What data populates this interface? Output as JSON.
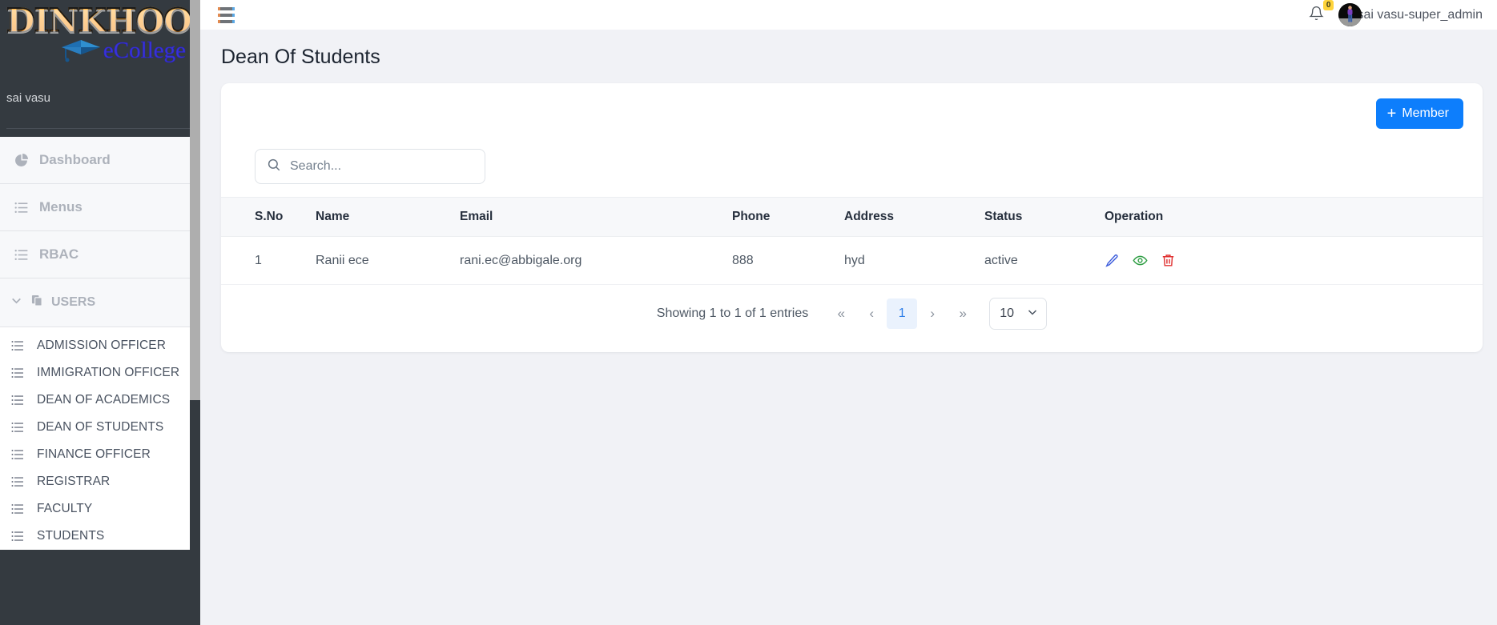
{
  "brand": {
    "title_top": "DINKHOO!",
    "title_bottom": "eCollege",
    "cap_icon": "graduation-cap-icon",
    "username": "sai vasu"
  },
  "sidebar": {
    "top_items": [
      {
        "label": "Dashboard",
        "icon": "pie-chart-icon"
      },
      {
        "label": "Menus",
        "icon": "list-icon"
      },
      {
        "label": "RBAC",
        "icon": "list-icon"
      }
    ],
    "users_group": {
      "label": "USERS",
      "icon": "copy-icon",
      "chevron": "chevron-down-icon",
      "expanded": true,
      "items": [
        {
          "label": "ADMISSION OFFICER",
          "icon": "list-icon"
        },
        {
          "label": "IMMIGRATION OFFICER",
          "icon": "list-icon"
        },
        {
          "label": "DEAN OF ACADEMICS",
          "icon": "list-icon"
        },
        {
          "label": "DEAN OF STUDENTS",
          "icon": "list-icon"
        },
        {
          "label": "FINANCE OFFICER",
          "icon": "list-icon"
        },
        {
          "label": "REGISTRAR",
          "icon": "list-icon"
        },
        {
          "label": "FACULTY",
          "icon": "list-icon"
        },
        {
          "label": "STUDENTS",
          "icon": "list-icon"
        }
      ]
    }
  },
  "topbar": {
    "menu_icon": "hamburger-icon",
    "bell_icon": "bell-icon",
    "notification_count": "0",
    "avatar": "user-avatar",
    "user_label": "sai vasu-super_admin"
  },
  "page": {
    "title": "Dean Of Students"
  },
  "toolbar": {
    "add_member_label": "Member",
    "add_member_plus": "+"
  },
  "search": {
    "icon": "search-icon",
    "placeholder": "Search...",
    "value": ""
  },
  "table": {
    "columns": [
      "S.No",
      "Name",
      "Email",
      "Phone",
      "Address",
      "Status",
      "Operation"
    ],
    "rows": [
      {
        "sno": "1",
        "name": "Ranii ece",
        "email": "rani.ec@abbigale.org",
        "phone": "888",
        "address": "hyd",
        "status": "active",
        "operations": [
          "edit-icon",
          "view-icon",
          "delete-icon"
        ]
      }
    ]
  },
  "pagination": {
    "showing": "Showing 1 to 1 of 1 entries",
    "first": "«",
    "prev": "‹",
    "current_page": "1",
    "next": "›",
    "last": "»",
    "page_size": "10",
    "page_size_chevron": "chevron-down-icon"
  },
  "colors": {
    "accent_blue": "#0d7efc",
    "sidebar_dark": "#343a40",
    "page_bg": "#f1f2f6",
    "edit_icon": "#3b5bdb",
    "view_icon": "#2f9e44",
    "delete_icon": "#e03131",
    "badge_yellow": "#ffd43b"
  }
}
